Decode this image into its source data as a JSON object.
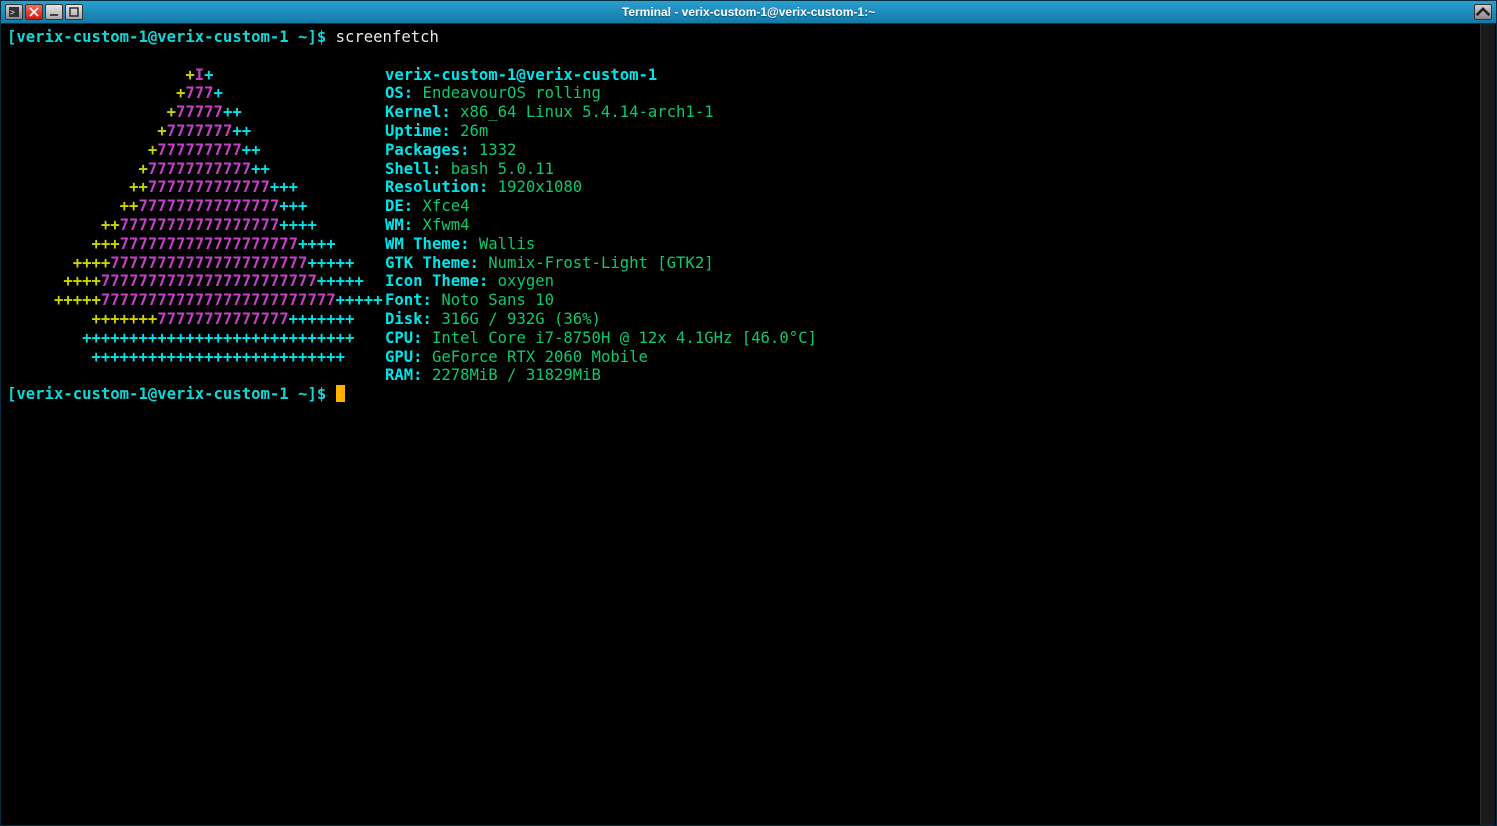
{
  "window": {
    "title": "Terminal - verix-custom-1@verix-custom-1:~"
  },
  "prompt": {
    "open_bracket": "[",
    "user_host": "verix-custom-1@verix-custom-1",
    "path": " ~",
    "close": "]$ ",
    "command": "screenfetch",
    "cursor": "█"
  },
  "screenfetch": {
    "header": "verix-custom-1@verix-custom-1",
    "info": [
      {
        "label": "OS:",
        "value": " EndeavourOS rolling"
      },
      {
        "label": "Kernel:",
        "value": " x86_64 Linux 5.4.14-arch1-1"
      },
      {
        "label": "Uptime:",
        "value": " 26m"
      },
      {
        "label": "Packages:",
        "value": " 1332"
      },
      {
        "label": "Shell:",
        "value": " bash 5.0.11"
      },
      {
        "label": "Resolution:",
        "value": " 1920x1080"
      },
      {
        "label": "DE:",
        "value": " Xfce4"
      },
      {
        "label": "WM:",
        "value": " Xfwm4"
      },
      {
        "label": "WM Theme:",
        "value": " Wallis"
      },
      {
        "label": "GTK Theme:",
        "value": " Numix-Frost-Light [GTK2]"
      },
      {
        "label": "Icon Theme:",
        "value": " oxygen"
      },
      {
        "label": "Font:",
        "value": " Noto Sans 10"
      },
      {
        "label": "Disk:",
        "value": " 316G / 932G (36%)"
      },
      {
        "label": "CPU:",
        "value": " Intel Core i7-8750H @ 12x 4.1GHz [46.0°C]"
      },
      {
        "label": "GPU:",
        "value": " GeForce RTX 2060 Mobile"
      },
      {
        "label": "RAM:",
        "value": " 2278MiB / 31829MiB"
      }
    ],
    "logo": [
      {
        "pad": "                   ",
        "y": "+",
        "m": "I",
        "c": "+"
      },
      {
        "pad": "                  ",
        "y": "+",
        "m": "777",
        "c": "+"
      },
      {
        "pad": "                 ",
        "y": "+",
        "m": "77777",
        "c": "++"
      },
      {
        "pad": "                ",
        "y": "+",
        "m": "7777777",
        "c": "++"
      },
      {
        "pad": "               ",
        "y": "+",
        "m": "777777777",
        "c": "++"
      },
      {
        "pad": "              ",
        "y": "+",
        "m": "77777777777",
        "c": "++"
      },
      {
        "pad": "             ",
        "y": "++",
        "m": "7777777777777",
        "c": "+++"
      },
      {
        "pad": "            ",
        "y": "++",
        "m": "777777777777777",
        "c": "+++"
      },
      {
        "pad": "          ",
        "y": "++",
        "m": "77777777777777777",
        "c": "++++"
      },
      {
        "pad": "         ",
        "y": "+++",
        "m": "7777777777777777777",
        "c": "++++"
      },
      {
        "pad": "       ",
        "y": "++++",
        "m": "777777777777777777777",
        "c": "+++++"
      },
      {
        "pad": "      ",
        "y": "++++",
        "m": "77777777777777777777777",
        "c": "+++++"
      },
      {
        "pad": "     ",
        "y": "+++++",
        "m": "7777777777777777777777777",
        "c": "+++++"
      },
      {
        "pad": "         ",
        "y": "+++++++",
        "m": "77777777777777",
        "c": "+++++++"
      },
      {
        "pad": "        ",
        "y": "",
        "m": "",
        "c": "+++++++++++++++++++++++++++++"
      },
      {
        "pad": "         ",
        "y": "",
        "m": "",
        "c": "+++++++++++++++++++++++++++"
      }
    ]
  }
}
